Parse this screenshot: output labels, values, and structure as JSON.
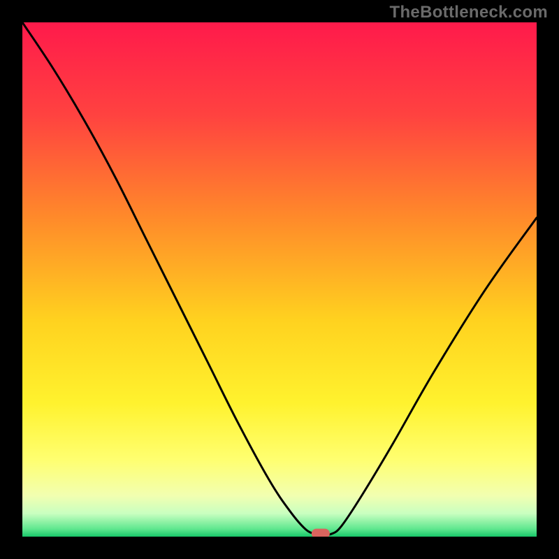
{
  "watermark": "TheBottleneck.com",
  "chart_data": {
    "type": "line",
    "title": "",
    "xlabel": "",
    "ylabel": "",
    "xlim": [
      0,
      100
    ],
    "ylim": [
      0,
      100
    ],
    "grid": false,
    "series": [
      {
        "name": "bottleneck-curve",
        "x": [
          0,
          6,
          12,
          18,
          24,
          30,
          36,
          42,
          48,
          52,
          55,
          57,
          58.5,
          60,
          62,
          66,
          72,
          80,
          90,
          100
        ],
        "y": [
          100,
          91,
          81,
          70,
          58,
          46,
          34,
          22,
          11,
          5,
          1.5,
          0.5,
          0.5,
          0.5,
          2,
          8,
          18,
          32,
          48,
          62
        ]
      }
    ],
    "marker": {
      "x": 58,
      "y": 0.6,
      "color": "#d9645e"
    },
    "gradient_stops": [
      {
        "offset": 0.0,
        "color": "#ff1a4b"
      },
      {
        "offset": 0.18,
        "color": "#ff4240"
      },
      {
        "offset": 0.38,
        "color": "#ff8a2a"
      },
      {
        "offset": 0.58,
        "color": "#ffd21f"
      },
      {
        "offset": 0.74,
        "color": "#fff22e"
      },
      {
        "offset": 0.85,
        "color": "#ffff70"
      },
      {
        "offset": 0.92,
        "color": "#f2ffb0"
      },
      {
        "offset": 0.955,
        "color": "#c9ffc0"
      },
      {
        "offset": 0.985,
        "color": "#5fe78f"
      },
      {
        "offset": 1.0,
        "color": "#18c76a"
      }
    ]
  }
}
